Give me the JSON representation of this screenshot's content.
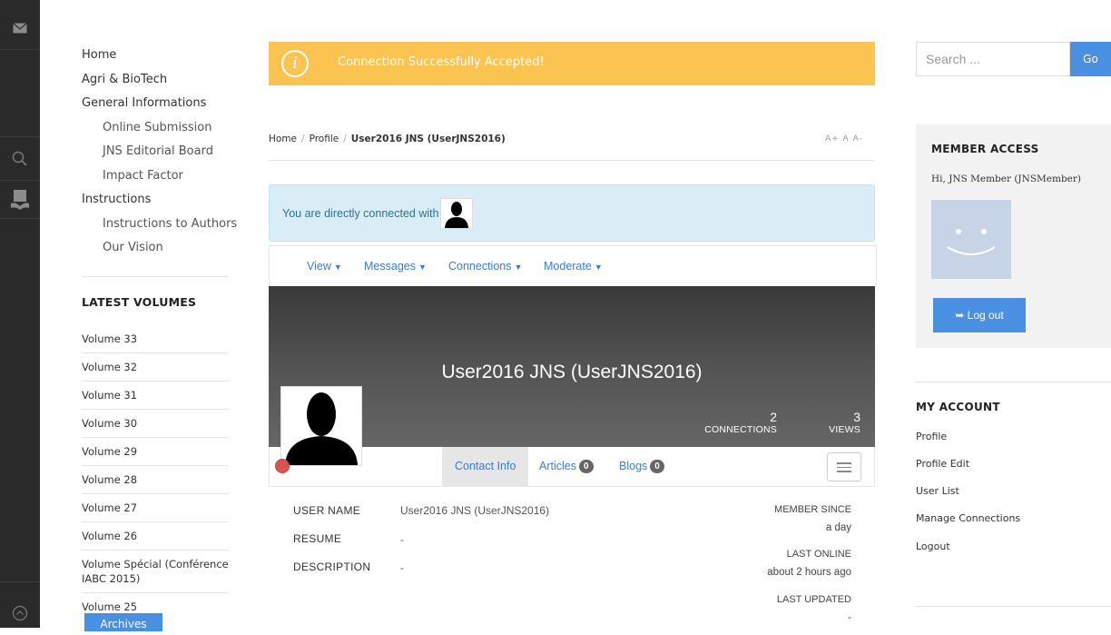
{
  "nav": {
    "items": [
      {
        "label": "Home",
        "sub": false
      },
      {
        "label": "Agri & BioTech",
        "sub": false
      },
      {
        "label": "General Informations",
        "sub": false
      },
      {
        "label": "Online Submission",
        "sub": true
      },
      {
        "label": "JNS Editorial Board",
        "sub": true
      },
      {
        "label": "Impact Factor",
        "sub": true
      },
      {
        "label": "Instructions",
        "sub": false
      },
      {
        "label": "Instructions to Authors",
        "sub": true
      },
      {
        "label": "Our Vision",
        "sub": true
      }
    ]
  },
  "volumes": {
    "title": "LATEST VOLUMES",
    "items": [
      "Volume 33",
      "Volume 32",
      "Volume 31",
      "Volume 30",
      "Volume 29",
      "Volume 28",
      "Volume 27",
      "Volume 26",
      "Volume Spécial (Conférence IABC 2015)",
      "Volume 25"
    ],
    "archive_label": "Archives"
  },
  "alert": {
    "text": "Connection Successfully Accepted!",
    "icon": "info-icon"
  },
  "breadcrumb": {
    "home": "Home",
    "profile": "Profile",
    "current": "User2016 JNS (UserJNS2016)",
    "font_controls": "A+ A A-"
  },
  "connection_info": {
    "text": "You are directly connected with"
  },
  "profile_nav": {
    "view": "View",
    "messages": "Messages",
    "connections": "Connections",
    "moderate": "Moderate"
  },
  "profile": {
    "name": "User2016 JNS (UserJNS2016)",
    "connections_count": "2",
    "connections_label": "CONNECTIONS",
    "views_count": "3",
    "views_label": "VIEWS",
    "status_color": "#d9534f"
  },
  "tabs": {
    "contact": "Contact Info",
    "articles": "Articles",
    "articles_count": "0",
    "blogs": "Blogs",
    "blogs_count": "0"
  },
  "details": {
    "username_label": "USER NAME",
    "username_value": "User2016 JNS (UserJNS2016)",
    "resume_label": "RESUME",
    "resume_value": "-",
    "description_label": "DESCRIPTION",
    "description_value": "-",
    "member_since_label": "MEMBER SINCE",
    "member_since_value": "a day",
    "last_online_label": "LAST ONLINE",
    "last_online_value": "about 2 hours ago",
    "last_updated_label": "LAST UPDATED",
    "last_updated_value": "-"
  },
  "search": {
    "placeholder": "Search ...",
    "button": "Go"
  },
  "member": {
    "title": "MEMBER ACCESS",
    "greeting": "Hi, JNS Member (JNSMember)",
    "logout": "Log out"
  },
  "account": {
    "title": "MY ACCOUNT",
    "items": [
      "Profile",
      "Profile Edit",
      "User List",
      "Manage Connections",
      "Logout"
    ]
  },
  "colors": {
    "alert": "#fbc34f",
    "accent": "#4a90e2",
    "info_bg": "#d9edf7"
  }
}
